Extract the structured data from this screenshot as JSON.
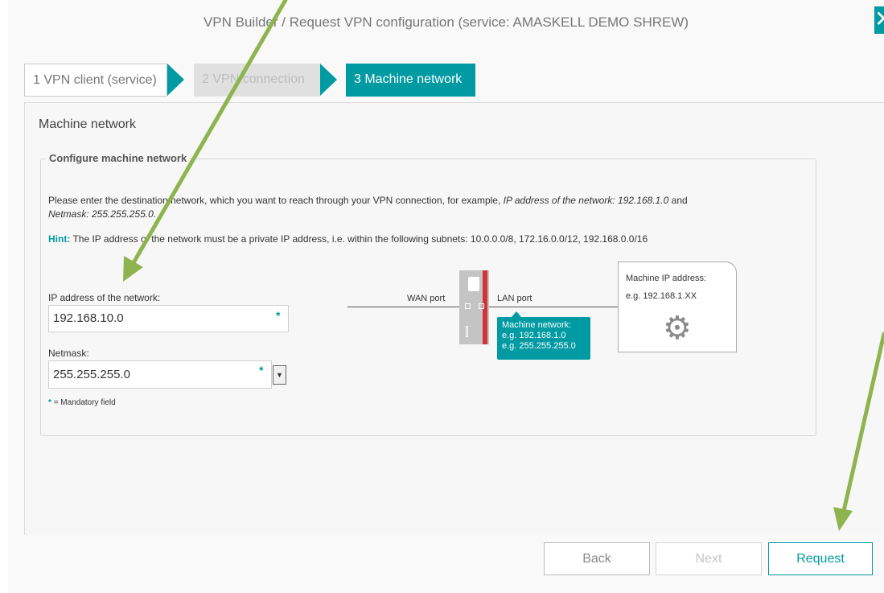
{
  "dialog": {
    "title": "VPN Builder / Request VPN configuration (service: AMASKELL DEMO SHREW)",
    "close_icon": "close-icon"
  },
  "wizard": {
    "steps": [
      {
        "label": "1  VPN client (service)",
        "state": "done"
      },
      {
        "label": "2  VPN connection",
        "state": "disabled"
      },
      {
        "label": "3  Machine network",
        "state": "active"
      }
    ]
  },
  "panel": {
    "title": "Machine network",
    "fieldset_legend": "Configure machine network",
    "description_plain1": "Please enter the destination network, which you want to reach through your VPN connection, for example, ",
    "description_italic1": "IP address of the network: 192.168.1.0",
    "description_plain2": " and ",
    "description_italic2": "Netmask: 255.255.255.0.",
    "hint_label": "Hint:",
    "hint_text": " The IP address of the network must be a private IP address, i.e. within the following subnets: 10.0.0.0/8, 172.16.0.0/12, 192.168.0.0/16"
  },
  "form": {
    "ip_label": "IP address of the network:",
    "ip_value": "192.168.10.0",
    "netmask_label": "Netmask:",
    "netmask_value": "255.255.255.0",
    "required_marker": "*",
    "mandatory_note": "= Mandatory field"
  },
  "diagram": {
    "wan_label": "WAN port",
    "lan_label": "LAN port",
    "network_title": "Machine network:",
    "network_example_ip": "e.g. 192.168.1.0",
    "network_example_mask": "e.g. 255.255.255.0",
    "machine_title": "Machine IP address:",
    "machine_example": "e.g. 192.168.1.XX",
    "machine_icon": "gear-icon"
  },
  "footer": {
    "back_label": "Back",
    "next_label": "Next",
    "request_label": "Request"
  },
  "colors": {
    "accent": "#009aa3",
    "annotation_arrow": "#8fb34f",
    "router_red": "#d13438"
  }
}
